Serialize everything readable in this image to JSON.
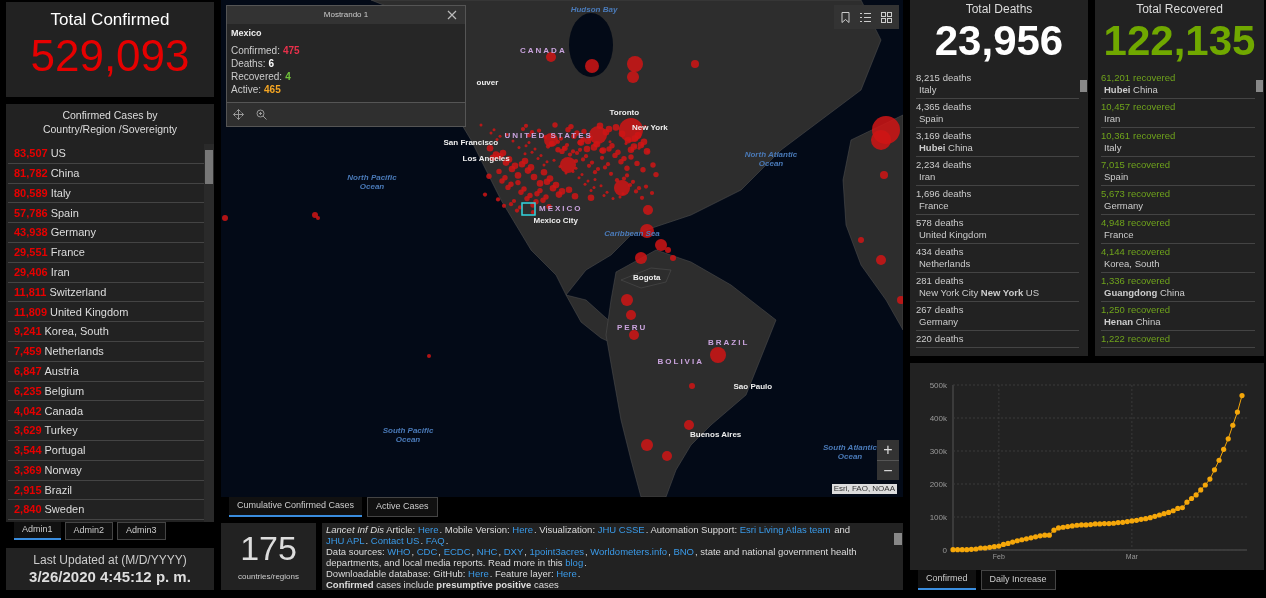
{
  "total_confirmed": {
    "title": "Total Confirmed",
    "value": "529,093"
  },
  "country_list": {
    "title": "Confirmed Cases by Country/Region /Sovereignty",
    "rows": [
      {
        "count": "83,507",
        "name": "US"
      },
      {
        "count": "81,782",
        "name": "China"
      },
      {
        "count": "80,589",
        "name": "Italy"
      },
      {
        "count": "57,786",
        "name": "Spain"
      },
      {
        "count": "43,938",
        "name": "Germany"
      },
      {
        "count": "29,551",
        "name": "France"
      },
      {
        "count": "29,406",
        "name": "Iran"
      },
      {
        "count": "11,811",
        "name": "Switzerland"
      },
      {
        "count": "11,809",
        "name": "United Kingdom"
      },
      {
        "count": "9,241",
        "name": "Korea, South"
      },
      {
        "count": "7,459",
        "name": "Netherlands"
      },
      {
        "count": "6,847",
        "name": "Austria"
      },
      {
        "count": "6,235",
        "name": "Belgium"
      },
      {
        "count": "4,042",
        "name": "Canada"
      },
      {
        "count": "3,629",
        "name": "Turkey"
      },
      {
        "count": "3,544",
        "name": "Portugal"
      },
      {
        "count": "3,369",
        "name": "Norway"
      },
      {
        "count": "2,915",
        "name": "Brazil"
      },
      {
        "count": "2,840",
        "name": "Sweden"
      }
    ]
  },
  "admin_tabs": [
    {
      "label": "Admin1",
      "selected": true
    },
    {
      "label": "Admin2",
      "selected": false
    },
    {
      "label": "Admin3",
      "selected": false
    }
  ],
  "last_updated": {
    "label": "Last Updated at (M/D/YYYY)",
    "value": "3/26/2020 4:45:12 p. m."
  },
  "map": {
    "labels": [
      {
        "kind": "ocean",
        "text": "Hudson Bay"
      },
      {
        "kind": "country",
        "text": "CANADA"
      },
      {
        "kind": "city",
        "text": "ouver"
      },
      {
        "kind": "ocean",
        "text": "North Pacific Ocean"
      },
      {
        "kind": "country",
        "text": "UNITED STATES"
      },
      {
        "kind": "city",
        "text": "San Francisco"
      },
      {
        "kind": "city",
        "text": "Los Angeles"
      },
      {
        "kind": "city",
        "text": "Toronto"
      },
      {
        "kind": "city",
        "text": "New York"
      },
      {
        "kind": "ocean",
        "text": "North Atlantic Ocean"
      },
      {
        "kind": "country",
        "text": "MEXICO"
      },
      {
        "kind": "city",
        "text": "Mexico City"
      },
      {
        "kind": "ocean",
        "text": "Caribbean Sea"
      },
      {
        "kind": "city",
        "text": "Bogota"
      },
      {
        "kind": "country",
        "text": "PERU"
      },
      {
        "kind": "country",
        "text": "BRAZIL"
      },
      {
        "kind": "country",
        "text": "BOLIVIA"
      },
      {
        "kind": "city",
        "text": "Sao Paulo"
      },
      {
        "kind": "ocean",
        "text": "South Pacific Ocean"
      },
      {
        "kind": "city",
        "text": "Buenos Aires"
      },
      {
        "kind": "ocean",
        "text": "South Atlantic Ocean"
      }
    ],
    "popup": {
      "title": "Mostrando 1",
      "heading": "Mexico",
      "fields": [
        {
          "label": "Confirmed:",
          "value": "475",
          "color": "#e8304a"
        },
        {
          "label": "Deaths:",
          "value": "6",
          "color": "#ffffff"
        },
        {
          "label": "Recovered:",
          "value": "4",
          "color": "#70c23a"
        },
        {
          "label": "Active:",
          "value": "465",
          "color": "#f5a623"
        }
      ]
    },
    "zoom_in": "+",
    "zoom_out": "−",
    "attribution": "Esri, FAO, NOAA"
  },
  "map_tabs": [
    {
      "label": "Cumulative Confirmed Cases",
      "selected": true
    },
    {
      "label": "Active Cases",
      "selected": false
    }
  ],
  "country_count": {
    "value": "175",
    "label": "countries/regions"
  },
  "info": {
    "paragraphs": [
      [
        {
          "kind": "text",
          "text": "*Lancet Inf Dis* Article: "
        },
        {
          "kind": "link",
          "text": "Here"
        },
        {
          "kind": "text",
          "text": ". Mobile Version: "
        },
        {
          "kind": "link",
          "text": "Here"
        },
        {
          "kind": "text",
          "text": ". Visualization: "
        },
        {
          "kind": "link",
          "text": "JHU CSSE"
        },
        {
          "kind": "text",
          "text": ". Automation Support: "
        },
        {
          "kind": "link",
          "text": "Esri Living Atlas team"
        },
        {
          "kind": "text",
          "text": " and "
        },
        {
          "kind": "link",
          "text": "JHU APL"
        },
        {
          "kind": "text",
          "text": ". "
        },
        {
          "kind": "link",
          "text": "Contact US"
        },
        {
          "kind": "text",
          "text": ". "
        },
        {
          "kind": "link",
          "text": "FAQ"
        },
        {
          "kind": "text",
          "text": "."
        }
      ],
      [
        {
          "kind": "text",
          "text": "Data sources: "
        },
        {
          "kind": "link",
          "text": "WHO"
        },
        {
          "kind": "text",
          "text": ", "
        },
        {
          "kind": "link",
          "text": "CDC"
        },
        {
          "kind": "text",
          "text": ", "
        },
        {
          "kind": "link",
          "text": "ECDC"
        },
        {
          "kind": "text",
          "text": ", "
        },
        {
          "kind": "link",
          "text": "NHC"
        },
        {
          "kind": "text",
          "text": ", "
        },
        {
          "kind": "link",
          "text": "DXY"
        },
        {
          "kind": "text",
          "text": ", "
        },
        {
          "kind": "link",
          "text": "1point3acres"
        },
        {
          "kind": "text",
          "text": ", "
        },
        {
          "kind": "link",
          "text": "Worldometers.info"
        },
        {
          "kind": "text",
          "text": ", "
        },
        {
          "kind": "link",
          "text": "BNO"
        },
        {
          "kind": "text",
          "text": ", state and national government health departments, and local media reports.  Read more in this "
        },
        {
          "kind": "link",
          "text": "blog"
        },
        {
          "kind": "text",
          "text": "."
        }
      ],
      [
        {
          "kind": "text",
          "text": "Downloadable database: GitHub: "
        },
        {
          "kind": "link",
          "text": "Here"
        },
        {
          "kind": "text",
          "text": ". Feature layer: "
        },
        {
          "kind": "link",
          "text": "Here"
        },
        {
          "kind": "text",
          "text": "."
        }
      ],
      [
        {
          "kind": "text",
          "text": "**Confirmed** cases include **presumptive positive** cases"
        }
      ]
    ]
  },
  "total_deaths": {
    "title": "Total Deaths",
    "value": "23,956",
    "items": [
      {
        "count": "8,215",
        "unit": "deaths",
        "place": "Italy"
      },
      {
        "count": "4,365",
        "unit": "deaths",
        "place": "Spain"
      },
      {
        "count": "3,169",
        "unit": "deaths",
        "place": "**Hubei** China"
      },
      {
        "count": "2,234",
        "unit": "deaths",
        "place": "Iran"
      },
      {
        "count": "1,696",
        "unit": "deaths",
        "place": "France"
      },
      {
        "count": "578",
        "unit": "deaths",
        "place": "United Kingdom"
      },
      {
        "count": "434",
        "unit": "deaths",
        "place": "Netherlands"
      },
      {
        "count": "281",
        "unit": "deaths",
        "place": "New York City **New York** US"
      },
      {
        "count": "267",
        "unit": "deaths",
        "place": "Germany"
      },
      {
        "count": "220",
        "unit": "deaths"
      }
    ]
  },
  "total_recovered": {
    "title": "Total Recovered",
    "value": "122,135",
    "items": [
      {
        "count": "61,201",
        "unit": "recovered",
        "place": "**Hubei** China"
      },
      {
        "count": "10,457",
        "unit": "recovered",
        "place": "Iran"
      },
      {
        "count": "10,361",
        "unit": "recovered",
        "place": "Italy"
      },
      {
        "count": "7,015",
        "unit": "recovered",
        "place": "Spain"
      },
      {
        "count": "5,673",
        "unit": "recovered",
        "place": "Germany"
      },
      {
        "count": "4,948",
        "unit": "recovered",
        "place": "France"
      },
      {
        "count": "4,144",
        "unit": "recovered",
        "place": "Korea, South"
      },
      {
        "count": "1,336",
        "unit": "recovered",
        "place": "**Guangdong** China"
      },
      {
        "count": "1,250",
        "unit": "recovered",
        "place": "**Henan** China"
      },
      {
        "count": "1,222",
        "unit": "recovered"
      }
    ]
  },
  "chart": {
    "chart_data": {
      "type": "line",
      "categories": [
        null,
        null,
        null,
        null,
        null,
        null,
        null,
        null,
        null,
        null,
        "Feb",
        null,
        null,
        null,
        null,
        null,
        null,
        null,
        null,
        null,
        null,
        null,
        null,
        null,
        null,
        null,
        null,
        null,
        null,
        null,
        null,
        null,
        null,
        null,
        null,
        null,
        null,
        null,
        null,
        "Mar",
        null,
        null,
        null,
        null,
        null,
        null,
        null,
        null,
        null,
        null,
        null,
        null,
        null,
        null,
        null,
        null,
        null,
        null,
        null,
        null,
        null,
        null,
        null,
        null
      ],
      "series": [
        {
          "color": "#f5a70a",
          "values": [
            1000,
            1000,
            1000,
            1000,
            2000,
            3000,
            6000,
            6000,
            8000,
            10000,
            12000,
            17000,
            20000,
            24000,
            28000,
            31000,
            34000,
            37000,
            40000,
            43000,
            45000,
            45000,
            60000,
            67000,
            69000,
            71000,
            73000,
            75000,
            76000,
            76000,
            77000,
            79000,
            79000,
            80000,
            80000,
            81000,
            83000,
            84000,
            86000,
            88000,
            90000,
            93000,
            95000,
            98000,
            102000,
            106000,
            110000,
            114000,
            119000,
            126000,
            128000,
            145000,
            156000,
            167000,
            182000,
            197000,
            215000,
            243000,
            272000,
            305000,
            337000,
            378000,
            418000,
            468000
          ]
        }
      ],
      "grid": true,
      "ylim": [
        0,
        500000
      ],
      "yticks": [
        {
          "value": 0,
          "label": "0"
        },
        {
          "value": 100000,
          "label": "100k"
        },
        {
          "value": 200000,
          "label": "200k"
        },
        {
          "value": 300000,
          "label": "300k"
        },
        {
          "value": 400000,
          "label": "400k"
        },
        {
          "value": 500000,
          "label": "500k"
        }
      ]
    }
  },
  "chart_tabs": [
    {
      "label": "Confirmed",
      "selected": true
    },
    {
      "label": "Daily Increase",
      "selected": false
    }
  ]
}
